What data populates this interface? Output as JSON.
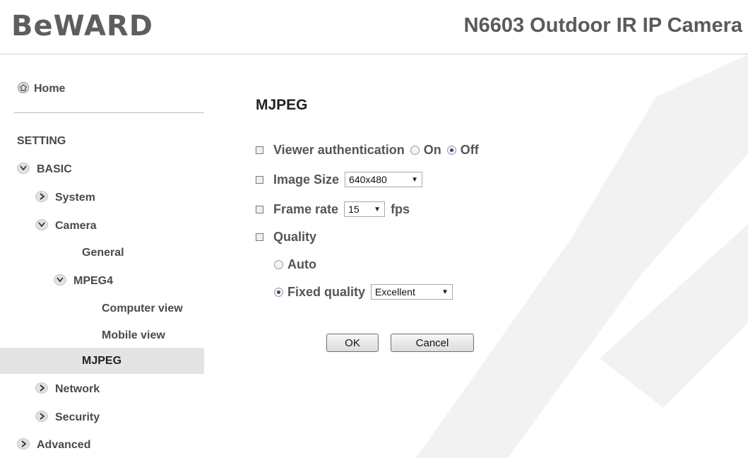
{
  "header": {
    "logo": "BeWARD",
    "product_title": "N6603 Outdoor IR IP Camera"
  },
  "sidebar": {
    "home": "Home",
    "setting": "SETTING",
    "basic": "BASIC",
    "system": "System",
    "camera": "Camera",
    "general": "General",
    "mpeg4": "MPEG4",
    "computer_view": "Computer view",
    "mobile_view": "Mobile view",
    "mjpeg": "MJPEG",
    "network": "Network",
    "security": "Security",
    "advanced": "Advanced"
  },
  "main": {
    "title": "MJPEG",
    "viewer_auth_label": "Viewer authentication",
    "auth_on": "On",
    "auth_off": "Off",
    "auth_selected": "Off",
    "image_size_label": "Image Size",
    "image_size_value": "640x480",
    "frame_rate_label": "Frame rate",
    "frame_rate_value": "15",
    "frame_rate_unit": "fps",
    "quality_label": "Quality",
    "quality_auto": "Auto",
    "quality_fixed": "Fixed quality",
    "quality_selected": "Fixed quality",
    "fixed_quality_value": "Excellent",
    "ok_label": "OK",
    "cancel_label": "Cancel"
  },
  "colors": {
    "text": "#4a4a4a",
    "selected_bg": "#e4e4e4",
    "watermark": "#f2f2f2"
  }
}
